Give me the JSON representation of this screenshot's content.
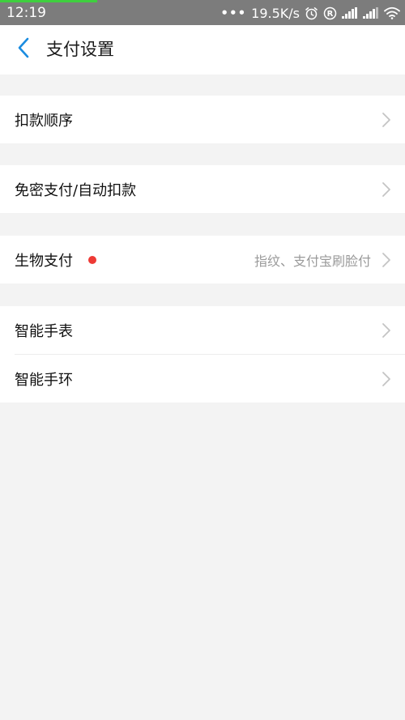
{
  "status_bar": {
    "time": "12:19",
    "dots": "•••",
    "net_speed": "19.5K/s",
    "icons": [
      "alarm-icon",
      "registered-icon",
      "signal-icon",
      "signal-icon",
      "wifi-icon"
    ],
    "load_progress": 0.24
  },
  "header": {
    "back_icon": "chevron-left-icon",
    "title": "支付设置",
    "accent_color": "#1a8ce0"
  },
  "sections": [
    {
      "items": [
        {
          "label": "扣款顺序",
          "detail": "",
          "dot": false
        }
      ]
    },
    {
      "items": [
        {
          "label": "免密支付/自动扣款",
          "detail": "",
          "dot": false
        }
      ]
    },
    {
      "items": [
        {
          "label": "生物支付",
          "detail": "指纹、支付宝刷脸付",
          "dot": true,
          "dot_color": "#ee3a35"
        }
      ]
    },
    {
      "items": [
        {
          "label": "智能手表",
          "detail": "",
          "dot": false
        },
        {
          "label": "智能手环",
          "detail": "",
          "dot": false
        }
      ]
    }
  ]
}
